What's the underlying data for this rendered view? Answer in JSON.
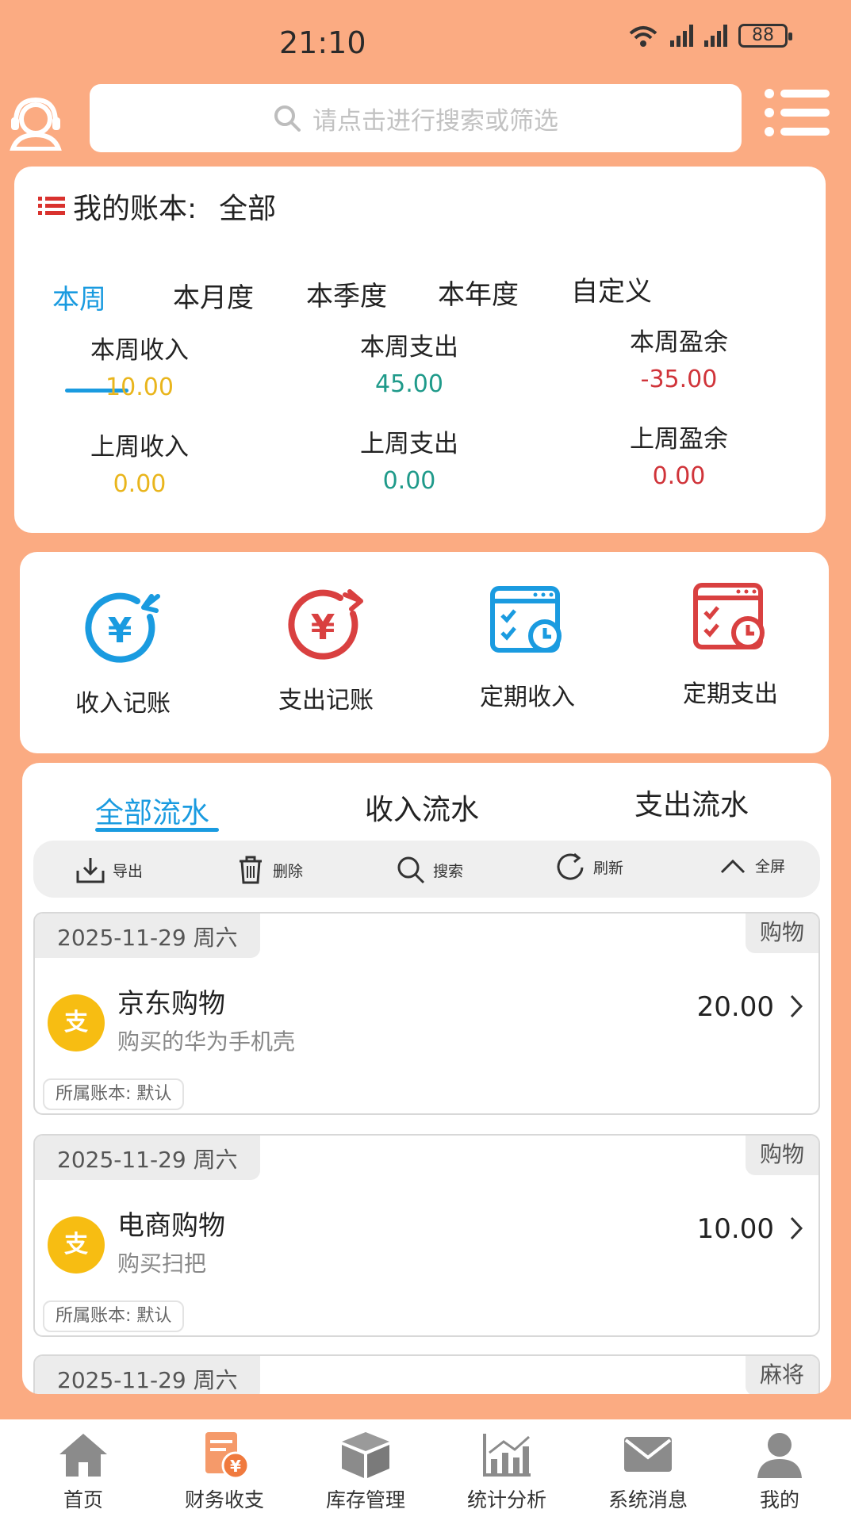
{
  "status_bar": {
    "time": "21:10",
    "wifi_label": "6",
    "signal1_label": "5G",
    "signal2_label": "4G",
    "battery": "88"
  },
  "header": {
    "support_icon": "headset-user-icon",
    "search_placeholder": "请点击进行搜索或筛选",
    "menu_icon": "list-menu-icon"
  },
  "book": {
    "title": "我的账本:",
    "value": "全部",
    "periods": [
      "本周",
      "本月度",
      "本季度",
      "本年度",
      "自定义"
    ],
    "active_period": 0,
    "stats": [
      {
        "label": "本周收入",
        "value": "10.00",
        "color": "#e9b51c"
      },
      {
        "label": "本周支出",
        "value": "45.00",
        "color": "#1f9a8a"
      },
      {
        "label": "本周盈余",
        "value": "-35.00",
        "color": "#d0343a"
      },
      {
        "label": "上周收入",
        "value": "0.00",
        "color": "#e9b51c"
      },
      {
        "label": "上周支出",
        "value": "0.00",
        "color": "#1f9a8a"
      },
      {
        "label": "上周盈余",
        "value": "0.00",
        "color": "#d0343a"
      }
    ]
  },
  "actions": [
    {
      "label": "收入记账",
      "icon": "income-yuan-icon",
      "color": "#1a9be0"
    },
    {
      "label": "支出记账",
      "icon": "expense-yuan-icon",
      "color": "#d94040"
    },
    {
      "label": "定期收入",
      "icon": "scheduled-income-icon",
      "color": "#1a9be0"
    },
    {
      "label": "定期支出",
      "icon": "scheduled-expense-icon",
      "color": "#d94040"
    }
  ],
  "flow": {
    "tabs": [
      "全部流水",
      "收入流水",
      "支出流水"
    ],
    "active_tab": 0,
    "toolbar": [
      {
        "label": "导出",
        "icon": "export-icon"
      },
      {
        "label": "删除",
        "icon": "trash-icon"
      },
      {
        "label": "搜索",
        "icon": "search-icon"
      },
      {
        "label": "刷新",
        "icon": "refresh-icon"
      },
      {
        "label": "全屏",
        "icon": "chevron-up-icon"
      }
    ],
    "records": [
      {
        "date": "2025-11-29 周六",
        "category": "购物",
        "badge": "支",
        "title": "京东购物",
        "desc": "购买的华为手机壳",
        "amount": "20.00",
        "book": "所属账本: 默认"
      },
      {
        "date": "2025-11-29 周六",
        "category": "购物",
        "badge": "支",
        "title": "电商购物",
        "desc": "购买扫把",
        "amount": "10.00",
        "book": "所属账本: 默认"
      },
      {
        "date": "2025-11-29 周六",
        "category": "麻将",
        "badge": "",
        "title": "",
        "desc": "",
        "amount": "",
        "book": ""
      }
    ]
  },
  "nav": {
    "items": [
      {
        "label": "首页",
        "icon": "home-icon"
      },
      {
        "label": "财务收支",
        "icon": "finance-icon"
      },
      {
        "label": "库存管理",
        "icon": "inventory-box-icon"
      },
      {
        "label": "统计分析",
        "icon": "chart-icon"
      },
      {
        "label": "系统消息",
        "icon": "mail-icon"
      },
      {
        "label": "我的",
        "icon": "user-icon"
      }
    ],
    "active": 1
  }
}
